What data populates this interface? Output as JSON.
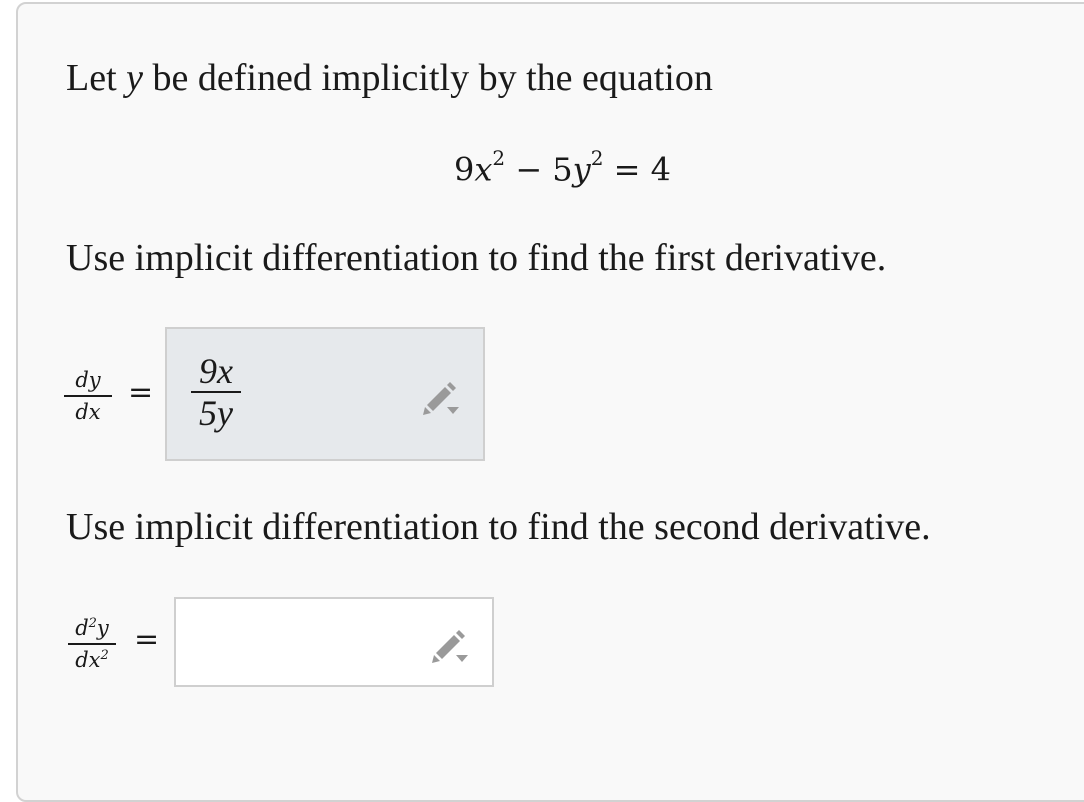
{
  "problem": {
    "intro_before": "Let",
    "intro_var": "y",
    "intro_after": "be defined implicitly by the equation",
    "equation": {
      "coef1": "9",
      "var1": "x",
      "exp1": "2",
      "minus": "−",
      "coef2": "5",
      "var2": "y",
      "exp2": "2",
      "equals": "=",
      "rhs": "4"
    },
    "prompt_first": "Use implicit differentiation to find the first derivative.",
    "prompt_second": "Use implicit differentiation to find the second derivative."
  },
  "first_derivative": {
    "lhs_num": "dy",
    "lhs_den": "dx",
    "equals": "=",
    "answer_num": "9x",
    "answer_den": "5y"
  },
  "second_derivative": {
    "lhs_num_d": "d",
    "lhs_num_exp": "2",
    "lhs_num_var": "y",
    "lhs_den_var": "dx",
    "lhs_den_exp": "2",
    "equals": "=",
    "answer": ""
  },
  "icons": {
    "edit": "pencil-dropdown-icon"
  },
  "colors": {
    "card_bg": "#f9f9f9",
    "filled_box_bg": "#e6e9ec",
    "empty_box_bg": "#ffffff",
    "icon": "#9a9a9a"
  }
}
